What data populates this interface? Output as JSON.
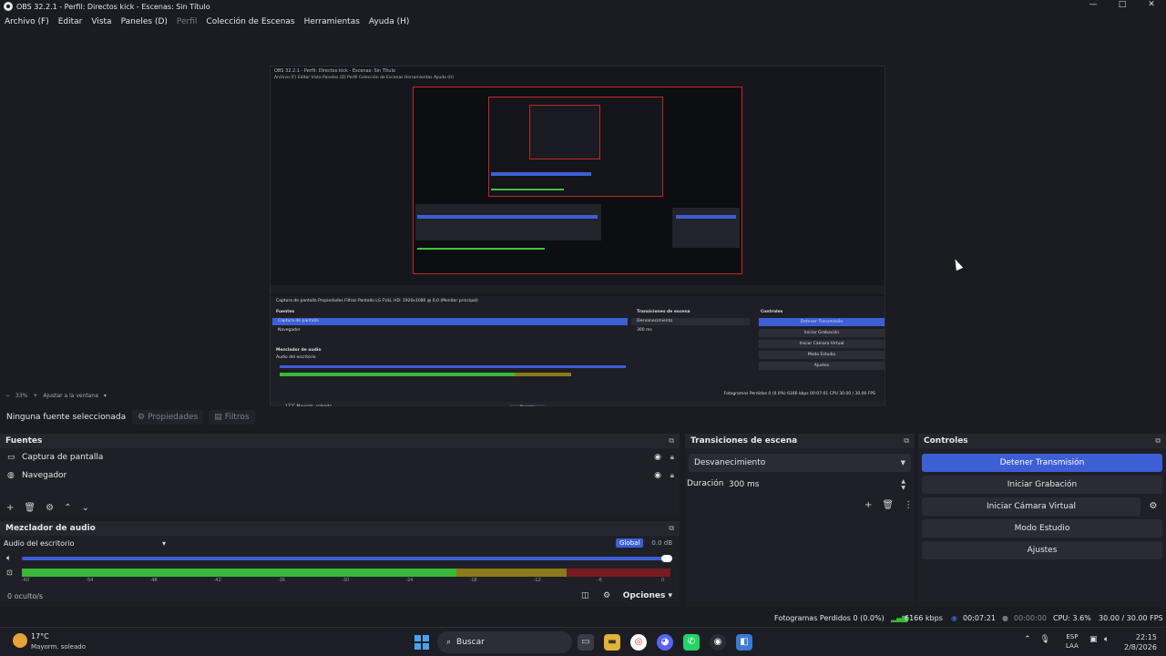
{
  "window": {
    "title": "OBS 32.2.1 - Perfil: Directos kick - Escenas: Sin Título",
    "min": "—",
    "max": "□",
    "close": "✕"
  },
  "menu": {
    "items": [
      "Archivo (F)",
      "Editar",
      "Vista",
      "Paneles (D)",
      "Perfil",
      "Colección de Escenas",
      "Herramientas",
      "Ayuda (H)"
    ]
  },
  "preview": {
    "nested_title": "OBS 32.2.1 - Perfil: Directos kick - Escenas: Sin Título",
    "nested_menu": "Archivo (F)   Editar   Vista   Paneles (D)   Perfil   Colección de Escenas   Herramientas   Ayuda (H)",
    "nested_source_bar": "Captura de pantalla     Propiedades     Filtros     Pantalla     LG FULL HD: 1920x1080 @ 0,0 (Monitor principal)",
    "nested_sources": [
      "Captura de pantalla",
      "Navegador"
    ],
    "nested_transition": "Desvanecimiento",
    "nested_duration": "300 ms",
    "nested_controls": [
      "Detener Transmisión",
      "Iniciar Grabación",
      "Iniciar Cámara Virtual",
      "Modo Estudio",
      "Ajustes"
    ],
    "nested_docks": [
      "Fuentes",
      "Transiciones de escena",
      "Controles",
      "Mezclador de audio"
    ],
    "nested_mixer_track": "Audio del escritorio",
    "nested_status": "Fotogramas Perdidos 0 (0.0%)   6166 kbps   00:07:01   CPU   30.00 / 30.00 FPS",
    "nested_weather": "17°C Mayorm. soleado",
    "nested_search": "Buscar"
  },
  "zoom": {
    "minus": "−",
    "level": "33%",
    "plus": "+",
    "fit": "Ajustar a la ventana"
  },
  "source_bar": {
    "none_label": "Ninguna fuente seleccionada",
    "properties": "Propiedades",
    "filters": "Filtros"
  },
  "sources": {
    "title": "Fuentes",
    "items": [
      {
        "label": "Captura de pantalla",
        "icon": "monitor-icon"
      },
      {
        "label": "Navegador",
        "icon": "globe-icon"
      }
    ]
  },
  "mixer": {
    "title": "Mezclador de audio",
    "track": "Audio del escritorio",
    "global": "Global",
    "db": "0.0 dB",
    "volume_fraction": 1.0,
    "meter": {
      "green_fraction": 0.67,
      "yellow_fraction": 0.18,
      "red_from": 0.84
    },
    "ticks": [
      "-60",
      "-54",
      "-48",
      "-42",
      "-36",
      "-30",
      "-24",
      "-18",
      "-12",
      "-6",
      "0"
    ],
    "hidden": "0 oculto/s",
    "options": "Opciones"
  },
  "transitions": {
    "title": "Transiciones de escena",
    "selected": "Desvanecimiento",
    "duration_label": "Duración",
    "duration_value": "300 ms"
  },
  "controls": {
    "title": "Controles",
    "stop_stream": "Detener Transmisión",
    "start_recording": "Iniciar Grabación",
    "start_virtual_cam": "Iniciar Cámara Virtual",
    "studio_mode": "Modo Estudio",
    "settings": "Ajustes"
  },
  "status": {
    "dropped": "Fotogramas Perdidos 0 (0.0%)",
    "bitrate": "6166 kbps",
    "stream_time": "00:07:21",
    "rec_time": "00:00:00",
    "cpu": "CPU: 3.6%",
    "fps": "30.00 / 30.00 FPS"
  },
  "taskbar": {
    "temp": "17°C",
    "condition": "Mayorm. soleado",
    "search": "Buscar",
    "lang1": "ESP",
    "lang2": "LAA",
    "time": "22:15",
    "date": "2/8/2026"
  },
  "colors": {
    "accent": "#3c5fd6",
    "background": "#1b1c22",
    "panel": "#1f2027",
    "meter_green": "#3ab83a",
    "meter_red": "#7a1a22"
  }
}
